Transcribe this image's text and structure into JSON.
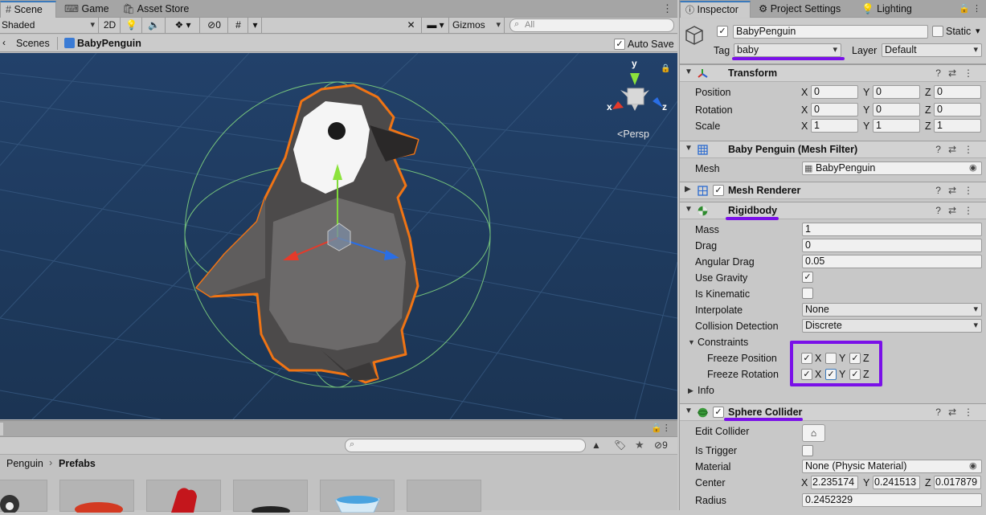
{
  "tabs": {
    "scene": "Scene",
    "game": "Game",
    "asset_store": "Asset Store"
  },
  "scene_toolbar": {
    "shading": "Shaded",
    "mode_2d": "2D",
    "hidden_count": "0",
    "gizmos": "Gizmos",
    "search_placeholder": "All"
  },
  "breadcrumb": {
    "scenes": "Scenes",
    "object": "BabyPenguin",
    "auto_save": "Auto Save"
  },
  "gizmo": {
    "y": "y",
    "x": "x",
    "z": "z",
    "projection": "Persp"
  },
  "project": {
    "hidden_count": "9",
    "path_root": "Penguin",
    "path_leaf": "Prefabs",
    "separator": "›"
  },
  "inspector_tabs": {
    "inspector": "Inspector",
    "project_settings": "Project Settings",
    "lighting": "Lighting"
  },
  "object": {
    "name": "BabyPenguin",
    "static_label": "Static",
    "tag_label": "Tag",
    "tag_value": "baby",
    "layer_label": "Layer",
    "layer_value": "Default"
  },
  "transform": {
    "title": "Transform",
    "position_label": "Position",
    "rotation_label": "Rotation",
    "scale_label": "Scale",
    "axis_x": "X",
    "axis_y": "Y",
    "axis_z": "Z",
    "position": {
      "x": "0",
      "y": "0",
      "z": "0"
    },
    "rotation": {
      "x": "0",
      "y": "0",
      "z": "0"
    },
    "scale": {
      "x": "1",
      "y": "1",
      "z": "1"
    }
  },
  "mesh_filter": {
    "title": "Baby Penguin (Mesh Filter)",
    "mesh_label": "Mesh",
    "mesh_value": "BabyPenguin"
  },
  "mesh_renderer": {
    "title": "Mesh Renderer"
  },
  "rigidbody": {
    "title": "Rigidbody",
    "mass_label": "Mass",
    "mass": "1",
    "drag_label": "Drag",
    "drag": "0",
    "angular_drag_label": "Angular Drag",
    "angular_drag": "0.05",
    "use_gravity_label": "Use Gravity",
    "use_gravity": "✓",
    "is_kinematic_label": "Is Kinematic",
    "is_kinematic": "",
    "interpolate_label": "Interpolate",
    "interpolate": "None",
    "collision_label": "Collision Detection",
    "collision": "Discrete",
    "constraints_label": "Constraints",
    "freeze_position_label": "Freeze Position",
    "freeze_rotation_label": "Freeze Rotation",
    "freeze_position": {
      "x": "✓",
      "y": "",
      "z": "✓"
    },
    "freeze_rotation": {
      "x": "✓",
      "y": "✓",
      "z": "✓"
    },
    "info_label": "Info"
  },
  "sphere_collider": {
    "title": "Sphere Collider",
    "edit_label": "Edit Collider",
    "is_trigger_label": "Is Trigger",
    "material_label": "Material",
    "material": "None (Physic Material)",
    "center_label": "Center",
    "center": {
      "x": "2.235174",
      "y": "0.241513",
      "z": "0.017879"
    },
    "radius_label": "Radius",
    "radius": "0.2452329"
  },
  "colors": {
    "highlight": "#7a10e8",
    "sky": "#1f3a5c",
    "selection_outline": "#f07414"
  }
}
